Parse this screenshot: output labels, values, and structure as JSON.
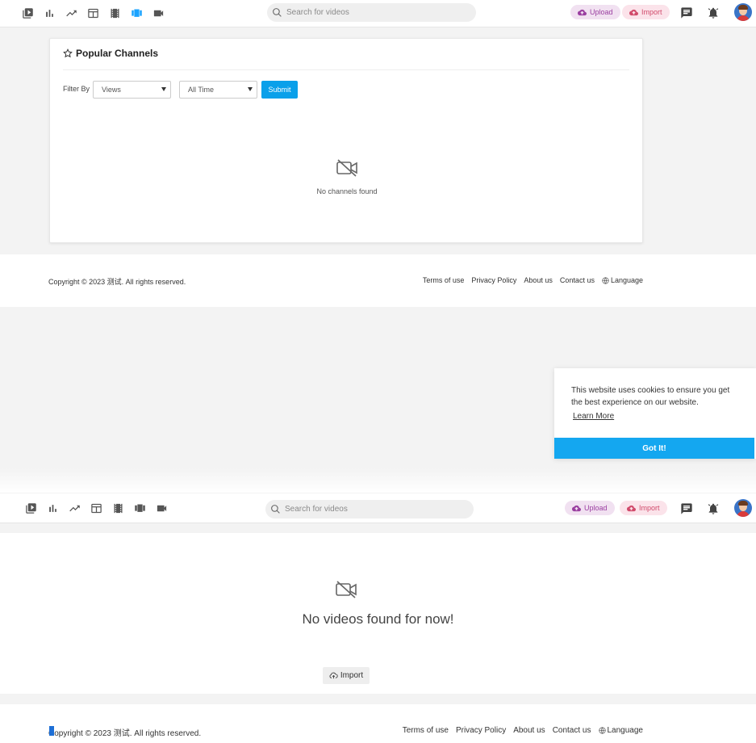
{
  "header": {
    "nav_icons": [
      "play-box-icon",
      "bar-chart-icon",
      "trending-icon",
      "layout-icon",
      "film-icon",
      "channels-icon",
      "video-camera-icon"
    ],
    "search_placeholder": "Search for videos",
    "upload_label": "Upload",
    "import_label": "Import",
    "colors": {
      "active": "#1aa3ff",
      "upload": "#9a3ea0",
      "import": "#d14a6b"
    }
  },
  "channels_card": {
    "title": "Popular Channels",
    "filter_label": "Filter By",
    "sort_select": "Views",
    "time_select": "All Time",
    "submit_label": "Submit",
    "empty_text": "No channels found"
  },
  "footer": {
    "copyright": "Copyright © 2023 测试. All rights reserved.",
    "links": [
      "Terms of use",
      "Privacy Policy",
      "About us",
      "Contact us"
    ],
    "language_label": "Language"
  },
  "cookie": {
    "message": "This website uses cookies to ensure you get the best experience on our website.",
    "learn_more": "Learn More",
    "accept": "Got It!",
    "accent": "#14a7f0"
  },
  "videos_section": {
    "empty_text": "No videos found for now!",
    "import_label": "Import"
  }
}
